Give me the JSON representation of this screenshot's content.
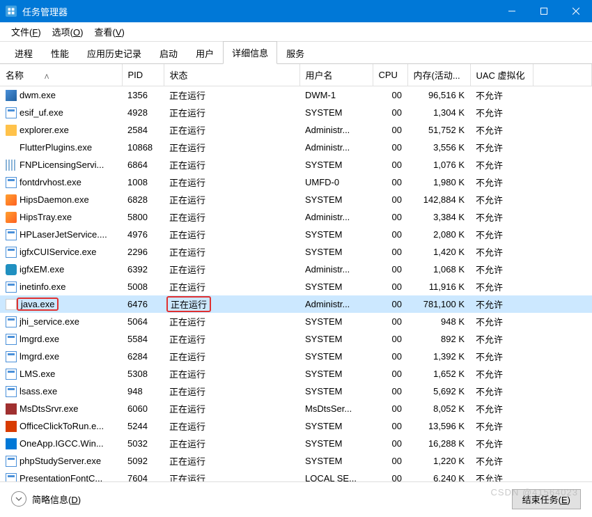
{
  "titlebar": {
    "title": "任务管理器"
  },
  "menu": {
    "file": {
      "label": "文件",
      "key": "F"
    },
    "options": {
      "label": "选项",
      "key": "O"
    },
    "view": {
      "label": "查看",
      "key": "V"
    }
  },
  "tabs": [
    {
      "label": "进程",
      "active": false
    },
    {
      "label": "性能",
      "active": false
    },
    {
      "label": "应用历史记录",
      "active": false
    },
    {
      "label": "启动",
      "active": false
    },
    {
      "label": "用户",
      "active": false
    },
    {
      "label": "详细信息",
      "active": true
    },
    {
      "label": "服务",
      "active": false
    }
  ],
  "columns": {
    "name": "名称",
    "pid": "PID",
    "status": "状态",
    "user": "用户名",
    "cpu": "CPU",
    "mem": "内存(活动...",
    "uac": "UAC 虚拟化"
  },
  "processes": [
    {
      "icon": "dwm",
      "name": "dwm.exe",
      "pid": "1356",
      "status": "正在运行",
      "user": "DWM-1",
      "cpu": "00",
      "mem": "96,516 K",
      "uac": "不允许"
    },
    {
      "icon": "default",
      "name": "esif_uf.exe",
      "pid": "4928",
      "status": "正在运行",
      "user": "SYSTEM",
      "cpu": "00",
      "mem": "1,304 K",
      "uac": "不允许"
    },
    {
      "icon": "folder",
      "name": "explorer.exe",
      "pid": "2584",
      "status": "正在运行",
      "user": "Administr...",
      "cpu": "00",
      "mem": "51,752 K",
      "uac": "不允许"
    },
    {
      "icon": "flutter",
      "name": "FlutterPlugins.exe",
      "pid": "10868",
      "status": "正在运行",
      "user": "Administr...",
      "cpu": "00",
      "mem": "3,556 K",
      "uac": "不允许"
    },
    {
      "icon": "fnp",
      "name": "FNPLicensingServi...",
      "pid": "6864",
      "status": "正在运行",
      "user": "SYSTEM",
      "cpu": "00",
      "mem": "1,076 K",
      "uac": "不允许"
    },
    {
      "icon": "default",
      "name": "fontdrvhost.exe",
      "pid": "1008",
      "status": "正在运行",
      "user": "UMFD-0",
      "cpu": "00",
      "mem": "1,980 K",
      "uac": "不允许"
    },
    {
      "icon": "hips",
      "name": "HipsDaemon.exe",
      "pid": "6828",
      "status": "正在运行",
      "user": "SYSTEM",
      "cpu": "00",
      "mem": "142,884 K",
      "uac": "不允许"
    },
    {
      "icon": "hips",
      "name": "HipsTray.exe",
      "pid": "5800",
      "status": "正在运行",
      "user": "Administr...",
      "cpu": "00",
      "mem": "3,384 K",
      "uac": "不允许"
    },
    {
      "icon": "default",
      "name": "HPLaserJetService....",
      "pid": "4976",
      "status": "正在运行",
      "user": "SYSTEM",
      "cpu": "00",
      "mem": "2,080 K",
      "uac": "不允许"
    },
    {
      "icon": "default",
      "name": "igfxCUIService.exe",
      "pid": "2296",
      "status": "正在运行",
      "user": "SYSTEM",
      "cpu": "00",
      "mem": "1,420 K",
      "uac": "不允许"
    },
    {
      "icon": "igfx",
      "name": "igfxEM.exe",
      "pid": "6392",
      "status": "正在运行",
      "user": "Administr...",
      "cpu": "00",
      "mem": "1,068 K",
      "uac": "不允许"
    },
    {
      "icon": "default",
      "name": "inetinfo.exe",
      "pid": "5008",
      "status": "正在运行",
      "user": "SYSTEM",
      "cpu": "00",
      "mem": "11,916 K",
      "uac": "不允许"
    },
    {
      "icon": "java",
      "name": "java.exe",
      "pid": "6476",
      "status": "正在运行",
      "user": "Administr...",
      "cpu": "00",
      "mem": "781,100 K",
      "uac": "不允许",
      "selected": true,
      "highlighted": true
    },
    {
      "icon": "default",
      "name": "jhi_service.exe",
      "pid": "5064",
      "status": "正在运行",
      "user": "SYSTEM",
      "cpu": "00",
      "mem": "948 K",
      "uac": "不允许"
    },
    {
      "icon": "default",
      "name": "lmgrd.exe",
      "pid": "5584",
      "status": "正在运行",
      "user": "SYSTEM",
      "cpu": "00",
      "mem": "892 K",
      "uac": "不允许"
    },
    {
      "icon": "default",
      "name": "lmgrd.exe",
      "pid": "6284",
      "status": "正在运行",
      "user": "SYSTEM",
      "cpu": "00",
      "mem": "1,392 K",
      "uac": "不允许"
    },
    {
      "icon": "default",
      "name": "LMS.exe",
      "pid": "5308",
      "status": "正在运行",
      "user": "SYSTEM",
      "cpu": "00",
      "mem": "1,652 K",
      "uac": "不允许"
    },
    {
      "icon": "default",
      "name": "lsass.exe",
      "pid": "948",
      "status": "正在运行",
      "user": "SYSTEM",
      "cpu": "00",
      "mem": "5,692 K",
      "uac": "不允许"
    },
    {
      "icon": "msdts",
      "name": "MsDtsSrvr.exe",
      "pid": "6060",
      "status": "正在运行",
      "user": "MsDtsSer...",
      "cpu": "00",
      "mem": "8,052 K",
      "uac": "不允许"
    },
    {
      "icon": "office",
      "name": "OfficeClickToRun.e...",
      "pid": "5244",
      "status": "正在运行",
      "user": "SYSTEM",
      "cpu": "00",
      "mem": "13,596 K",
      "uac": "不允许"
    },
    {
      "icon": "oneapp",
      "name": "OneApp.IGCC.Win...",
      "pid": "5032",
      "status": "正在运行",
      "user": "SYSTEM",
      "cpu": "00",
      "mem": "16,288 K",
      "uac": "不允许"
    },
    {
      "icon": "default",
      "name": "phpStudyServer.exe",
      "pid": "5092",
      "status": "正在运行",
      "user": "SYSTEM",
      "cpu": "00",
      "mem": "1,220 K",
      "uac": "不允许"
    },
    {
      "icon": "default",
      "name": "PresentationFontC...",
      "pid": "7604",
      "status": "正在运行",
      "user": "LOCAL SE...",
      "cpu": "00",
      "mem": "6,240 K",
      "uac": "不允许"
    }
  ],
  "footer": {
    "brief_info": "简略信息",
    "brief_key": "D",
    "end_task": "结束任务",
    "end_task_key": "E"
  },
  "watermark": "CSDN @41564023"
}
